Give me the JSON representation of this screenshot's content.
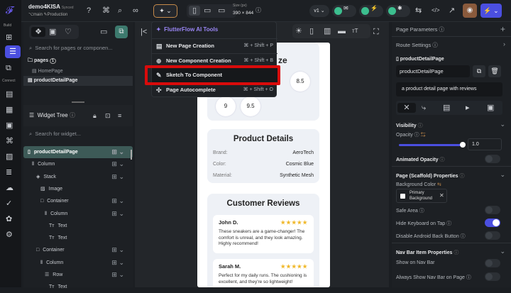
{
  "header": {
    "project": "demo4KISA",
    "sync": "Synced",
    "branch": "main",
    "env": "Production",
    "size_label": "Size (px)",
    "size_value": "390 × 844",
    "version": "v1"
  },
  "rail": {
    "build": "Build",
    "connect": "Connect"
  },
  "left": {
    "search_pages_placeholder": "Search for pages or componen...",
    "pages_label": "pages",
    "pages_count": "1",
    "pages": [
      "HomePage",
      "productDetailPage"
    ],
    "widget_tree_title": "Widget Tree",
    "search_widget_placeholder": "Search for widget...",
    "tree": [
      {
        "label": "productDetailPage",
        "indent": 0
      },
      {
        "label": "Column",
        "indent": 1
      },
      {
        "label": "Stack",
        "indent": 2
      },
      {
        "label": "Image",
        "indent": 3
      },
      {
        "label": "Container",
        "indent": 3
      },
      {
        "label": "Column",
        "indent": 4
      },
      {
        "label": "Text",
        "indent": 5
      },
      {
        "label": "Text",
        "indent": 5
      },
      {
        "label": "Container",
        "indent": 2
      },
      {
        "label": "Column",
        "indent": 3
      },
      {
        "label": "Row",
        "indent": 4
      },
      {
        "label": "Text",
        "indent": 5
      }
    ]
  },
  "menu": {
    "title": "FlutterFlow AI Tools",
    "items": [
      {
        "label": "New Page Creation",
        "shortcut": "⌘ + Shift + P"
      },
      {
        "label": "New Component Creation",
        "shortcut": "⌘ + Shift + B"
      },
      {
        "label": "Sketch To Component",
        "shortcut": ""
      },
      {
        "label": "Page Autocomplete",
        "shortcut": "⌘ + Shift + O"
      }
    ]
  },
  "phone": {
    "size_title_partial": "ze",
    "sizes": [
      "8.5",
      "9",
      "9.5"
    ],
    "details_title": "Product Details",
    "details": [
      {
        "k": "Brand:",
        "v": "AeroTech"
      },
      {
        "k": "Color:",
        "v": "Cosmic Blue"
      },
      {
        "k": "Material:",
        "v": "Synthetic Mesh"
      }
    ],
    "reviews_title": "Customer Reviews",
    "reviews": [
      {
        "name": "John D.",
        "stars": "★★★★★",
        "rating": 4.5,
        "text": "These sneakers are a game-changer! The comfort is unreal, and they look amazing. Highly recommend!"
      },
      {
        "name": "Sarah M.",
        "stars": "★★★★★",
        "rating": 5,
        "text": "Perfect for my daily runs. The cushioning is excellent, and they're so lightweight!"
      }
    ]
  },
  "right": {
    "page_params": "Page Parameters",
    "route": "Route Settings",
    "page_name_label": "productDetailPage",
    "page_name_value": "productDetailPage",
    "description": "a product detail page with reviews",
    "visibility": "Visibility",
    "opacity": "Opacity",
    "opacity_value": "1.0",
    "animated_opacity": "Animated Opacity",
    "scaffold": "Page (Scaffold) Properties",
    "bg_color": "Background Color",
    "bg_chip_1": "Primary",
    "bg_chip_2": "Background",
    "safe_area": "Safe Area",
    "hide_keyboard": "Hide Keyboard on Tap",
    "disable_back": "Disable Android Back Button",
    "navbar": "Nav Bar Item Properties",
    "show_nav": "Show on Nav Bar",
    "always_nav": "Always Show Nav Bar on Page"
  },
  "colors": {
    "accent": "#4b4fe0",
    "highlight": "#d90b0b",
    "success": "#3cbf8f"
  }
}
